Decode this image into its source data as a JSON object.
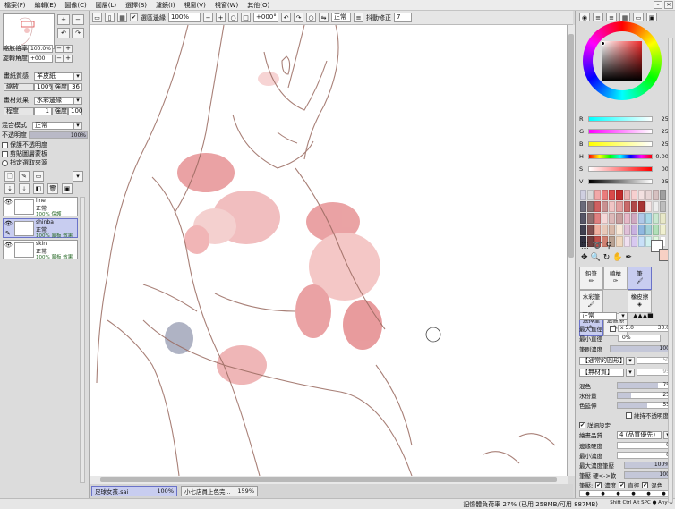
{
  "menu": [
    "檔案(F)",
    "編輯(E)",
    "圖像(C)",
    "圖層(L)",
    "選擇(S)",
    "濾鏡(I)",
    "視窗(V)",
    "視窗(W)",
    "其他(O)"
  ],
  "toolbar": {
    "anti_alias_label": "選區邊緣",
    "zoom": "100%",
    "rotation": "+000°",
    "blend": "正常",
    "stabilizer_label": "抖動修正",
    "stabilizer_value": "7"
  },
  "left": {
    "zoom_label": "縮放倍率",
    "zoom_value": "100.0%",
    "rotate_label": "旋轉角度",
    "rotate_value": "+000",
    "paper_texture_label": "畫紙質感",
    "paper_texture_value": "羊皮紙",
    "scale_label": "縮放",
    "scale_value": "100%",
    "strength_label": "強度",
    "strength_value": "36",
    "effect_label": "畫材效果",
    "effect_value": "水彩邊緣",
    "degree_label": "程度",
    "degree_value": "1",
    "intensity_label": "強度",
    "intensity_value": "100",
    "blend_label": "混合模式",
    "blend_value": "正常",
    "opacity_label": "不透明度",
    "opacity_value": "100%",
    "opacity_fraction": 1.0,
    "protect_label": "保護不透明度",
    "clip_label": "剪貼圖層蒙板",
    "select_src_label": "指定選取來源",
    "layers": [
      {
        "name": "line",
        "mode": "正常",
        "info": "100% 保護",
        "selected": false
      },
      {
        "name": "shinba",
        "mode": "正常",
        "info": "100% 蒙板 效果",
        "selected": true
      },
      {
        "name": "skin",
        "mode": "正常",
        "info": "100% 蒙板 效果",
        "selected": false
      }
    ]
  },
  "doc_tabs": [
    {
      "name": "足球女孩.sai",
      "zoom": "100%",
      "active": true
    },
    {
      "name": "小七店員上色完...",
      "zoom": "159%",
      "active": false
    }
  ],
  "status": {
    "memory": "記憶體負荷率 27% (已用 258MB/可用 887MB)",
    "keys": "Shift Ctrl Alt SPC ● Any ⊖"
  },
  "right": {
    "sliders": [
      {
        "label": "R",
        "value": "255"
      },
      {
        "label": "G",
        "value": "255"
      },
      {
        "label": "B",
        "value": "255"
      },
      {
        "label": "H",
        "value": "0.002"
      },
      {
        "label": "S",
        "value": "000"
      },
      {
        "label": "V",
        "value": "255"
      }
    ],
    "swatches": [
      "#cfcfe0",
      "#d8d8d8",
      "#f2a8a8",
      "#e97c7c",
      "#d94a4a",
      "#c02a2a",
      "#e9b0b0",
      "#f7cfcf",
      "#f3e0e0",
      "#e8d5d5",
      "#d6c0c0",
      "#a0a0a0",
      "#6b6b7a",
      "#8c7272",
      "#d06060",
      "#c89090",
      "#f0c4c4",
      "#e2a0a0",
      "#c96a6a",
      "#b04848",
      "#a83232",
      "#f4e6e6",
      "#ededed",
      "#bdbdbd",
      "#555566",
      "#907070",
      "#e08080",
      "#f6d8d8",
      "#dcb8b8",
      "#c89e9e",
      "#e6b8c8",
      "#d0a8c0",
      "#b0c8e8",
      "#a8d8e8",
      "#c8e8d0",
      "#e8e8c8",
      "#404050",
      "#805050",
      "#f0b0a0",
      "#e8c8b8",
      "#d8b8a8",
      "#f8e8d8",
      "#e0c0d8",
      "#c8b0e0",
      "#90b8e0",
      "#a0d0d8",
      "#b0e0b8",
      "#f0f0d0",
      "#303040",
      "#704040",
      "#c0504a",
      "#d08070",
      "#b8a090",
      "#f0d8c0",
      "#f0e0f0",
      "#d8c8f0",
      "#c8e0f8",
      "#d0f0f0",
      "#e0f8e0",
      "#ffffff"
    ],
    "tools": [
      "鉛筆",
      "噴槍",
      "筆",
      "水彩筆",
      "橡皮擦",
      "選擇筆",
      "選區擦"
    ],
    "tool_selected": "筆",
    "blend": "正常",
    "max_size_label": "最大直徑",
    "max_size_mult": "x 5.0",
    "max_size_value": "30.0",
    "min_size_label": "最小直徑",
    "min_size_value": "0%",
    "density_label": "筆刷濃度",
    "density_value": "100",
    "shape_label": "【通常的圓形】",
    "shape_value": "50",
    "texture_label": "【無材質】",
    "texture_value": "95",
    "blend_amt_label": "混色",
    "blend_amt_value": "75",
    "water_label": "水份量",
    "water_value": "25",
    "persist_label": "色延伸",
    "persist_value": "55",
    "keep_opacity_label": "維持不透明度",
    "detail_label": "詳細設定",
    "quality_label": "繪畫品質",
    "quality_value": "4 (品質優先)",
    "edge_label": "邊緣硬度",
    "edge_value": "0",
    "min_density_label": "最小濃度",
    "min_density_value": "0",
    "max_pressure_label": "最大濃度筆壓",
    "max_pressure_value": "100%",
    "hardness_label": "筆壓 硬<->軟",
    "hardness_value": "100",
    "pressure_label": "筆壓:",
    "pressure_density": "濃度",
    "pressure_size": "直徑",
    "pressure_blend": "混色"
  }
}
